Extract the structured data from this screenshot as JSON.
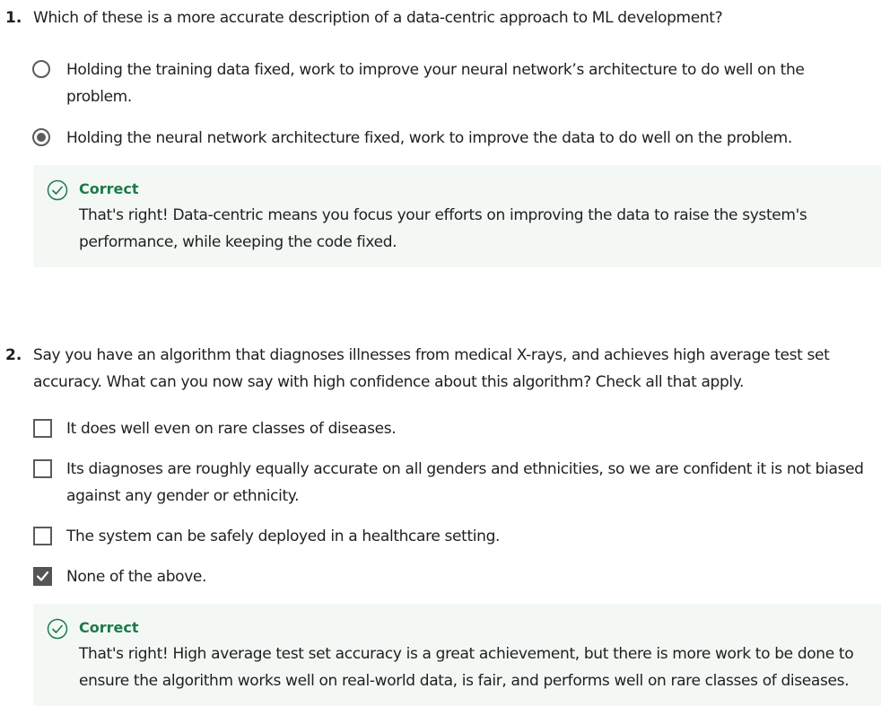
{
  "questions": [
    {
      "number": "1.",
      "text": "Which of these is a more accurate description of a data-centric approach to ML development?",
      "type": "radio",
      "options": [
        {
          "text": "Holding the training data fixed, work to improve your neural network’s architecture to do well on the problem.",
          "selected": false
        },
        {
          "text": "Holding the neural network architecture fixed, work to improve the data to do well on the problem.",
          "selected": true
        }
      ],
      "feedback": {
        "title": "Correct",
        "text": "That's right! Data-centric means you focus your efforts on improving the data to raise the system's performance, while keeping the code fixed."
      }
    },
    {
      "number": "2.",
      "text": "Say you have an algorithm that diagnoses illnesses from medical X-rays, and achieves high average test set accuracy. What can you now say with high confidence about this algorithm? Check all that apply.",
      "type": "checkbox",
      "options": [
        {
          "text": "It does well even on rare classes of diseases.",
          "selected": false
        },
        {
          "text": "Its diagnoses are roughly equally accurate on all genders and ethnicities, so we are confident it is not biased against any gender or ethnicity.",
          "selected": false
        },
        {
          "text": "The system can be safely deployed in a healthcare setting.",
          "selected": false
        },
        {
          "text": "None of the above.",
          "selected": true
        }
      ],
      "feedback": {
        "title": "Correct",
        "text": "That's right! High average test set accuracy is a great achievement, but there is more work to be done to ensure the algorithm works well on real-world data, is fair, and performs well on rare classes of diseases."
      }
    }
  ],
  "colors": {
    "correct_green": "#1d7a4a",
    "feedback_bg": "#f3f8f5",
    "control_gray": "#5b5b5b"
  },
  "icons": {
    "feedback": "check-circle-icon",
    "checkmark": "checkmark-icon"
  }
}
